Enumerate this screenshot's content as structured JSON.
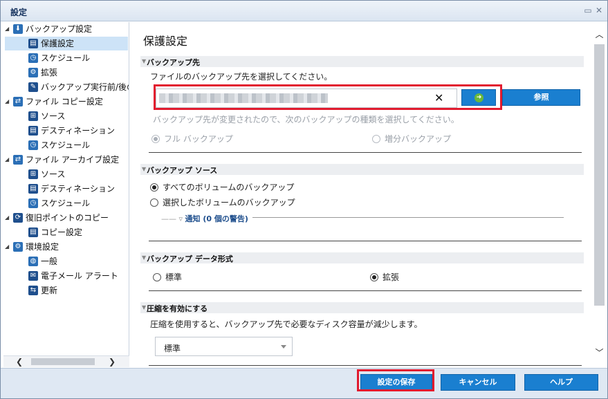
{
  "window": {
    "title": "設定"
  },
  "tree": [
    {
      "label": "バックアップ設定",
      "icon": "backup-settings-icon"
    },
    {
      "label": "保護設定",
      "icon": "protection-icon"
    },
    {
      "label": "スケジュール",
      "icon": "schedule-icon"
    },
    {
      "label": "拡張",
      "icon": "advanced-icon"
    },
    {
      "label": "バックアップ実行前/後の",
      "icon": "wrench-icon"
    },
    {
      "label": "ファイル コピー設定",
      "icon": "file-copy-icon"
    },
    {
      "label": "ソース",
      "icon": "source-icon"
    },
    {
      "label": "デスティネーション",
      "icon": "destination-icon"
    },
    {
      "label": "スケジュール",
      "icon": "schedule-icon"
    },
    {
      "label": "ファイル アーカイブ設定",
      "icon": "file-archive-icon"
    },
    {
      "label": "ソース",
      "icon": "source-icon"
    },
    {
      "label": "デスティネーション",
      "icon": "destination-icon"
    },
    {
      "label": "スケジュール",
      "icon": "schedule-icon"
    },
    {
      "label": "復旧ポイントのコピー",
      "icon": "recovery-point-icon"
    },
    {
      "label": "コピー設定",
      "icon": "copy-settings-icon"
    },
    {
      "label": "環境設定",
      "icon": "preferences-icon"
    },
    {
      "label": "一般",
      "icon": "general-icon"
    },
    {
      "label": "電子メール アラート",
      "icon": "email-icon"
    },
    {
      "label": "更新",
      "icon": "update-icon"
    }
  ],
  "main": {
    "title": "保護設定",
    "destination": {
      "header": "バックアップ先",
      "prompt": "ファイルのバックアップ先を選択してください。",
      "browse_label": "参照",
      "changed_note": "バックアップ先が変更されたので、次のバックアップの種類を選択してください。",
      "full_backup": "フル バックアップ",
      "incremental_backup": "増分バックアップ"
    },
    "source": {
      "header": "バックアップ ソース",
      "all_volumes": "すべてのボリュームのバックアップ",
      "selected_volumes": "選択したボリュームのバックアップ",
      "notice": "通知 (0 個の警告)"
    },
    "format": {
      "header": "バックアップ データ形式",
      "standard": "標準",
      "extended": "拡張"
    },
    "compression": {
      "header": "圧縮を有効にする",
      "description": "圧縮を使用すると、バックアップ先で必要なディスク容量が減少します。",
      "selected": "標準"
    }
  },
  "footer": {
    "save_label": "設定の保存",
    "cancel_label": "キャンセル",
    "help_label": "ヘルプ"
  },
  "colors": {
    "accent": "#1a7fd0",
    "highlight": "#e21b2f",
    "selected_row": "#cde3f7"
  }
}
